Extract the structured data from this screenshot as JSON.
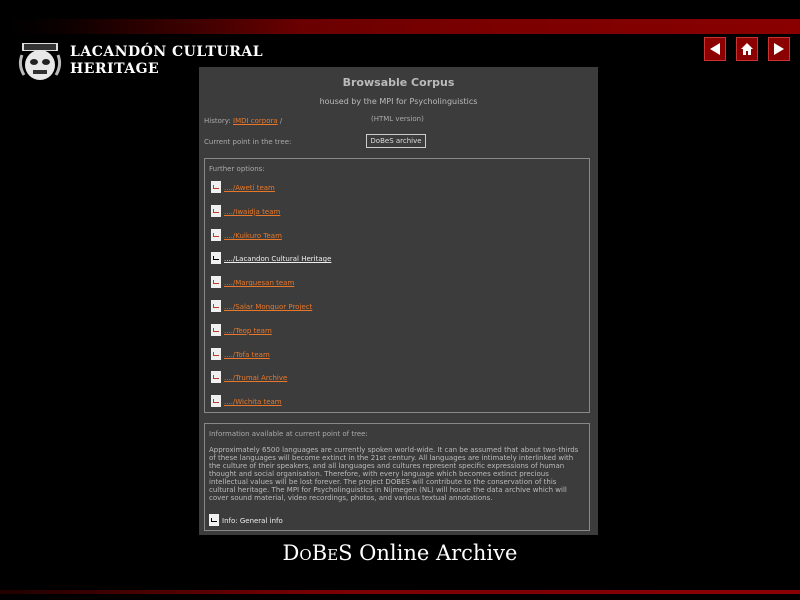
{
  "header": {
    "brand_line1": "LACANDÓN CULTURAL",
    "brand_line2": "HERITAGE",
    "nav": [
      "back-icon",
      "home-icon",
      "forward-icon"
    ],
    "accent": "#8b0000"
  },
  "panel": {
    "title": "Browsable Corpus",
    "subtitle": "housed by the MPI for Psycholinguistics",
    "history_label": "History:",
    "history_link": "IMDI corpora",
    "history_sep": "/",
    "html_version": "(HTML version)",
    "current_label": "Current point in the tree:",
    "current_value": "DoBeS archive",
    "options_label": "Further options:",
    "options": [
      {
        "label": "..../Awetí team",
        "current": false
      },
      {
        "label": "..../Iwaidja team",
        "current": false
      },
      {
        "label": "..../Kuikuro Team",
        "current": false
      },
      {
        "label": "..../Lacandon Cultural Heritage",
        "current": true
      },
      {
        "label": "..../Marquesan team",
        "current": false
      },
      {
        "label": "..../Salar Monguor Project",
        "current": false
      },
      {
        "label": "..../Teop team",
        "current": false
      },
      {
        "label": "..../Tofa team",
        "current": false
      },
      {
        "label": "..../Trumai Archive",
        "current": false
      },
      {
        "label": "..../Wichita team",
        "current": false
      }
    ],
    "info_label": "Information available at current point of tree:",
    "info_text": "Approximately 6500 languages are currently spoken world-wide. It can be assumed that about two-thirds of these languages will become extinct in the 21st century. All languages are intimately interlinked with the culture of their speakers, and all languages and cultures represent specific expressions of human thought and social organisation. Therefore, with every language which becomes extinct precious intellectual values will be lost forever. The project DOBES will contribute to the conservation of this cultural heritage. The MPI for Psycholinguistics in Nijmegen (NL) will house the data archive which will cover sound material, video recordings, photos, and various textual annotations.",
    "info_link": "Info: General info"
  },
  "footer": {
    "d": "D",
    "o": "O",
    "b": "B",
    "e": "E",
    "s": "S",
    "rest": " Online Archive"
  }
}
